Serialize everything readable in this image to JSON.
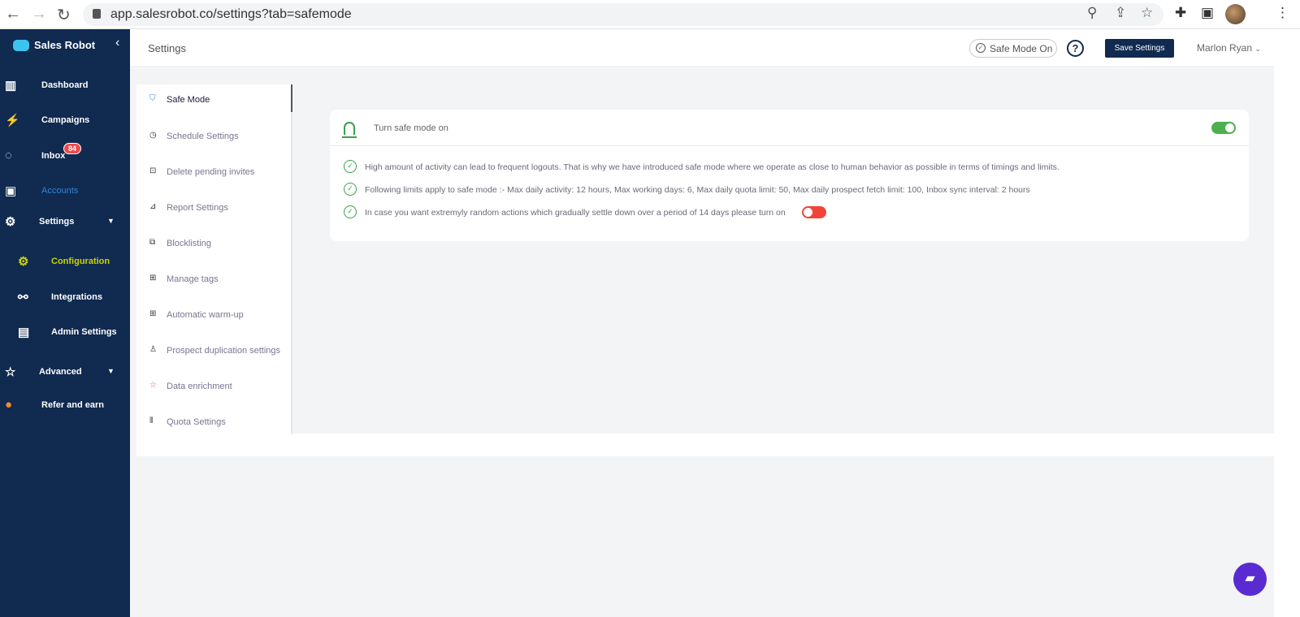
{
  "browser": {
    "url": "app.salesrobot.co/settings?tab=safemode"
  },
  "brand": {
    "name": "Sales Robot"
  },
  "sidebar": {
    "items": [
      {
        "label": "Dashboard",
        "icon": "bar-chart-icon"
      },
      {
        "label": "Campaigns",
        "icon": "lightning-icon"
      },
      {
        "label": "Inbox",
        "icon": "chat-icon",
        "badge": "84"
      },
      {
        "label": "Accounts",
        "icon": "linkedin-icon"
      },
      {
        "label": "Settings",
        "icon": "gear-icon"
      },
      {
        "label": "Configuration",
        "icon": "gear-icon"
      },
      {
        "label": "Integrations",
        "icon": "plug-icon"
      },
      {
        "label": "Admin Settings",
        "icon": "document-icon"
      },
      {
        "label": "Advanced",
        "icon": "star-icon"
      },
      {
        "label": "Refer and earn",
        "icon": "hand-coin-icon"
      }
    ]
  },
  "header": {
    "breadcrumb": "Settings",
    "safe_mode_pill": "Safe Mode On",
    "help": "?",
    "save_label": "Save Settings",
    "user": "Marlon Ryan"
  },
  "settings_nav": [
    "Safe Mode",
    "Schedule Settings",
    "Delete pending invites",
    "Report Settings",
    "Blocklisting",
    "Manage tags",
    "Automatic warm-up",
    "Prospect duplication settings",
    "Data enrichment",
    "Quota Settings"
  ],
  "card": {
    "title": "Turn safe mode on",
    "safe_mode_enabled": true,
    "lines": [
      "High amount of activity can lead to frequent logouts. That is why we have introduced safe mode where we operate as close to human behavior as possible in terms of timings and limits.",
      "Following limits apply to safe mode :- Max daily activity: 12 hours, Max working days: 6, Max daily quota limit: 50, Max daily prospect fetch limit: 100, Inbox sync interval: 2 hours",
      "In case you want extremyly random actions which gradually settle down over a period of 14 days please turn on"
    ],
    "random_actions_enabled": false
  },
  "colors": {
    "sidebar": "#102a50",
    "accent_green": "#4caf50",
    "toggle_off": "#f0443a",
    "active_yellow": "#c8d400",
    "accounts_blue": "#2f86d6",
    "chat": "#5a2bd0"
  }
}
